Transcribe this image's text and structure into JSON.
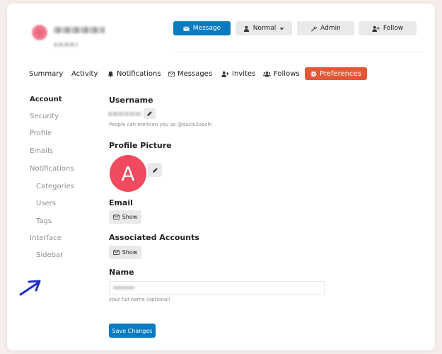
{
  "header": {
    "buttons": {
      "message": "Message",
      "normal": "Normal",
      "admin": "Admin",
      "follow": "Follow"
    }
  },
  "nav": {
    "summary": "Summary",
    "activity": "Activity",
    "notifications": "Notifications",
    "messages": "Messages",
    "invites": "Invites",
    "follows": "Follows",
    "preferences": "Preferences"
  },
  "sidebar": {
    "account": "Account",
    "security": "Security",
    "profile": "Profile",
    "emails": "Emails",
    "notifications": "Notifications",
    "categories": "Categories",
    "users": "Users",
    "tags": "Tags",
    "interface": "Interface",
    "sidebar": "Sidebar"
  },
  "form": {
    "username_label": "Username",
    "username_help": "People can mention you as @aachi2aachi",
    "profile_picture_label": "Profile Picture",
    "avatar_letter": "A",
    "email_label": "Email",
    "email_show": "Show",
    "associated_label": "Associated Accounts",
    "associated_show": "Show",
    "name_label": "Name",
    "name_help": "your full name (optional)",
    "save_label": "Save Changes"
  },
  "colors": {
    "primary": "#0a7bc0",
    "active_tab": "#e45735",
    "avatar_bg": "#ef4a5e"
  }
}
